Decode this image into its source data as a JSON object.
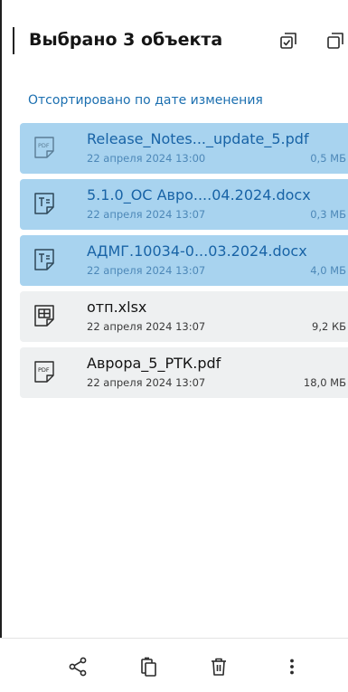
{
  "header": {
    "title": "Выбрано 3 объекта",
    "actions": [
      {
        "icon": "select-all-icon"
      },
      {
        "icon": "copy-icon"
      }
    ]
  },
  "sort_label": "Отсортировано по дате изменения",
  "files": [
    {
      "name": "Release_Notes..._update_5.pdf",
      "date": "22 апреля 2024 13:00",
      "size": "0,5 МБ",
      "type": "pdf",
      "icon": "pdf-file-icon",
      "selected": true
    },
    {
      "name": "5.1.0_ОС Авро....04.2024.docx",
      "date": "22 апреля 2024 13:07",
      "size": "0,3 МБ",
      "type": "docx",
      "icon": "document-file-icon",
      "selected": true
    },
    {
      "name": "АДМГ.10034-0...03.2024.docx",
      "date": "22 апреля 2024 13:07",
      "size": "4,0 МБ",
      "type": "docx",
      "icon": "document-file-icon",
      "selected": true
    },
    {
      "name": "отп.xlsx",
      "date": "22 апреля 2024 13:07",
      "size": "9,2 КБ",
      "type": "xlsx",
      "icon": "spreadsheet-file-icon",
      "selected": false
    },
    {
      "name": "Аврора_5_РТК.pdf",
      "date": "22 апреля 2024 13:07",
      "size": "18,0 МБ",
      "type": "pdf",
      "icon": "pdf-file-icon",
      "selected": false
    }
  ],
  "toolbar": {
    "actions": [
      {
        "icon": "share-icon"
      },
      {
        "icon": "clipboard-icon"
      },
      {
        "icon": "trash-icon"
      },
      {
        "icon": "more-vertical-icon"
      }
    ]
  },
  "colors": {
    "selected_row": "#a8d3ef",
    "unselected_row": "#eef0f1",
    "accent": "#1b6fb0"
  }
}
